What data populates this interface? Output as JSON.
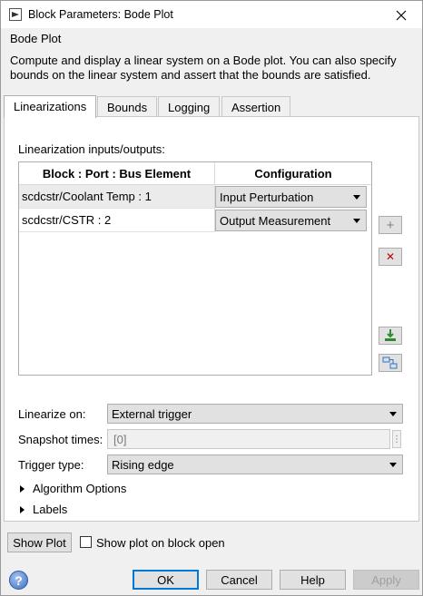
{
  "window": {
    "title": "Block Parameters: Bode Plot",
    "icon": "simulink-block-icon",
    "close_icon": "close-icon"
  },
  "group_label": "Bode Plot",
  "description": "Compute and display a linear system on a Bode plot. You can also specify bounds on the linear system and assert that the bounds are satisfied.",
  "tabs": [
    {
      "label": "Linearizations",
      "active": true
    },
    {
      "label": "Bounds",
      "active": false
    },
    {
      "label": "Logging",
      "active": false
    },
    {
      "label": "Assertion",
      "active": false
    }
  ],
  "io": {
    "label": "Linearization inputs/outputs:",
    "columns": [
      "Block : Port : Bus Element",
      "Configuration"
    ],
    "rows": [
      {
        "block": "scdcstr/Coolant Temp : 1",
        "config": "Input Perturbation"
      },
      {
        "block": "scdcstr/CSTR : 2",
        "config": "Output Measurement"
      }
    ]
  },
  "side_buttons": [
    {
      "name": "add-icon",
      "glyph": "+"
    },
    {
      "name": "delete-icon",
      "glyph": "✕"
    },
    {
      "name": "select-signals-icon"
    },
    {
      "name": "highlight-icon"
    }
  ],
  "linearize_on": {
    "label": "Linearize on:",
    "value": "External trigger"
  },
  "snapshot": {
    "label": "Snapshot times:",
    "value": "[0]",
    "dots": "⋮"
  },
  "trigger": {
    "label": "Trigger type:",
    "value": "Rising edge"
  },
  "sections": [
    "Algorithm Options",
    "Labels"
  ],
  "show_plot": {
    "button": "Show Plot",
    "checkbox_label": "Show plot on block open",
    "checked": false
  },
  "footer": {
    "ok": "OK",
    "cancel": "Cancel",
    "help": "Help",
    "apply": "Apply",
    "help_icon": "?"
  },
  "colors": {
    "accent": "#0078d7",
    "delete_red": "#c00000",
    "add_gray": "#808080",
    "download_green": "#2e8b2e"
  }
}
